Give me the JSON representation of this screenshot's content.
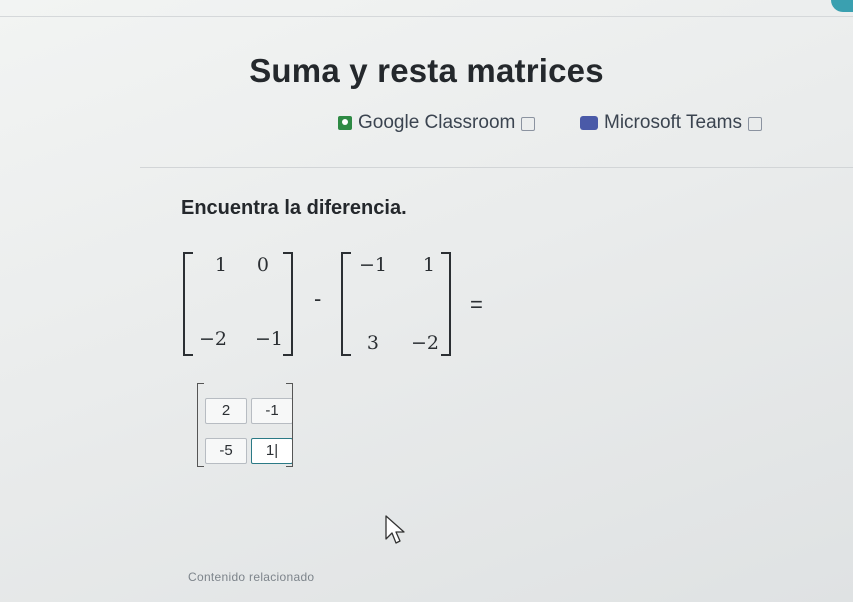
{
  "page": {
    "title": "Suma y resta matrices",
    "share": {
      "google_classroom": "Google Classroom",
      "microsoft_teams": "Microsoft Teams"
    }
  },
  "exercise": {
    "prompt": "Encuentra la diferencia.",
    "matrix_a": [
      [
        "1",
        "0"
      ],
      [
        "−2",
        "−1"
      ]
    ],
    "matrix_b": [
      [
        "−1",
        "1"
      ],
      [
        "3",
        "−2"
      ]
    ],
    "operator": "-",
    "equals": "=",
    "answer": [
      [
        "2",
        "-1"
      ],
      [
        "-5",
        "1|"
      ]
    ]
  },
  "footer": {
    "related_label": "Contenido relacionado"
  },
  "colors": {
    "accent": "#2b7a86",
    "classroom_icon": "#2e8a44",
    "teams_icon": "#4a5aa8"
  }
}
